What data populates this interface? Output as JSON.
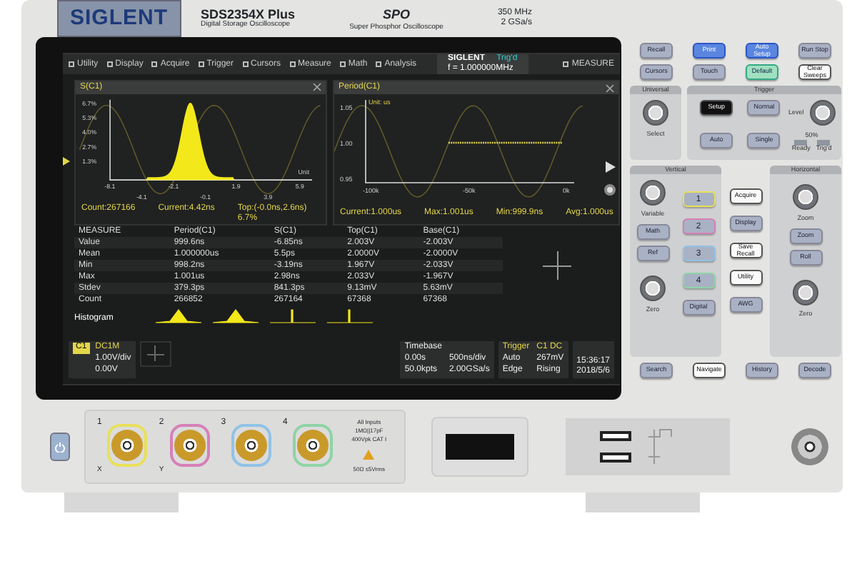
{
  "header": {
    "brand": "SIGLENT",
    "model": "SDS2354X Plus",
    "subtitle": "Digital Storage Oscilloscope",
    "tech_logo": "SPO",
    "tech_subtitle": "Super Phosphor Oscilloscope",
    "bandwidth": "350 MHz",
    "sample_rate": "2 GSa/s"
  },
  "screen": {
    "menu": [
      "Utility",
      "Display",
      "Acquire",
      "Trigger",
      "Cursors",
      "Measure",
      "Math",
      "Analysis"
    ],
    "brand": "SIGLENT",
    "trig_status": "Trig'd",
    "frequency": "f = 1.000000MHz",
    "mode": "MEASURE",
    "histogram_panel": {
      "title": "S(C1)",
      "yticks": [
        "6.7%",
        "5.3%",
        "4.0%",
        "2.7%",
        "1.3%"
      ],
      "xticks": [
        "-8.1",
        "-4.1",
        "-2.1",
        "-0.1",
        "1.9",
        "3.9",
        "5.9"
      ],
      "unit": "Unit",
      "stats": [
        "Count:267166",
        "Current:4.42ns",
        "Top:(-0.0ns,2.6ns) 6.7%"
      ]
    },
    "trend_panel": {
      "title": "Period(C1)",
      "unit": "Unit: us",
      "yticks": [
        "1.05",
        "1.00",
        "0.95"
      ],
      "xticks": [
        "-100k",
        "-50k",
        "0k"
      ],
      "stats": [
        "Current:1.000us",
        "Max:1.001us",
        "Min:999.9ns",
        "Avg:1.000us"
      ]
    },
    "table": {
      "columns": [
        "MEASURE",
        "Period(C1)",
        "S(C1)",
        "Top(C1)",
        "Base(C1)"
      ],
      "rows": [
        [
          "Value",
          "999.6ns",
          "-6.85ns",
          "2.003V",
          "-2.003V"
        ],
        [
          "Mean",
          "1.000000us",
          "5.5ps",
          "2.0000V",
          "-2.0000V"
        ],
        [
          "Min",
          "998.2ns",
          "-3.19ns",
          "1.967V",
          "-2.033V"
        ],
        [
          "Max",
          "1.001us",
          "2.98ns",
          "2.033V",
          "-1.967V"
        ],
        [
          "Stdev",
          "379.3ps",
          "841.3ps",
          "9.13mV",
          "5.63mV"
        ],
        [
          "Count",
          "266852",
          "267164",
          "67368",
          "67368"
        ]
      ],
      "histogram_label": "Histogram"
    },
    "channel": {
      "name": "C1",
      "coupling": "DC1M",
      "scale": "1.00V/div",
      "offset": "0.00V"
    },
    "timebase": {
      "title": "Timebase",
      "delay": "0.00s",
      "scale": "500ns/div",
      "points": "50.0kpts",
      "rate": "2.00GSa/s"
    },
    "trigger": {
      "title": "Trigger",
      "source": "C1 DC",
      "mode": "Auto",
      "level": "267mV",
      "type": "Edge",
      "slope": "Rising"
    },
    "clock": {
      "time": "15:36:17",
      "date": "2018/5/6"
    }
  },
  "panel": {
    "top_buttons": [
      {
        "label": "Recall",
        "kind": "gray"
      },
      {
        "label": "Print",
        "kind": "blue"
      },
      {
        "label": "Auto Setup",
        "kind": "blue"
      },
      {
        "label": "Run Stop",
        "kind": "gray"
      },
      {
        "label": "Cursors",
        "kind": "gray"
      },
      {
        "label": "Touch",
        "kind": "gray"
      },
      {
        "label": "Default",
        "kind": "green"
      },
      {
        "label": "Clear Sweeps",
        "kind": "white"
      }
    ],
    "universal": {
      "title": "Universal",
      "knob_label": "Select"
    },
    "trigger": {
      "title": "Trigger",
      "buttons": [
        {
          "label": "Setup",
          "kind": "black"
        },
        {
          "label": "Normal",
          "kind": "gray"
        },
        {
          "label": "Auto",
          "kind": "gray"
        },
        {
          "label": "Single",
          "kind": "gray"
        }
      ],
      "level_label": "Level",
      "level_hint": "50%",
      "indicators": [
        "Ready",
        "Trig'd"
      ]
    },
    "vertical": {
      "title": "Vertical",
      "knob_labels": [
        "Variable",
        "Zero"
      ],
      "buttons": [
        "Math",
        "Ref",
        "Digital"
      ],
      "channels": [
        {
          "label": "1",
          "color": "#e8e05a"
        },
        {
          "label": "2",
          "color": "#d77fb8"
        },
        {
          "label": "3",
          "color": "#8fc3e6"
        },
        {
          "label": "4",
          "color": "#8fd3a6"
        }
      ]
    },
    "middle": [
      {
        "label": "Acquire",
        "kind": "white"
      },
      {
        "label": "Display",
        "kind": "gray"
      },
      {
        "label": "Save Recall",
        "kind": "white"
      },
      {
        "label": "Utility",
        "kind": "white"
      },
      {
        "label": "AWG",
        "kind": "gray"
      }
    ],
    "horizontal": {
      "title": "Horizontal",
      "knob_labels": [
        "Zoom",
        "Zero"
      ],
      "buttons": [
        "Zoom",
        "Roll"
      ]
    },
    "bottom_buttons": [
      {
        "label": "Search",
        "kind": "gray"
      },
      {
        "label": "Navigate",
        "kind": "white"
      },
      {
        "label": "History",
        "kind": "gray"
      },
      {
        "label": "Decode",
        "kind": "gray"
      }
    ]
  },
  "inputs": {
    "connectors": [
      {
        "label": "1",
        "color": "#e8e05a",
        "axis": "X"
      },
      {
        "label": "2",
        "color": "#d77fb8",
        "axis": "Y"
      },
      {
        "label": "3",
        "color": "#8fc3e6"
      },
      {
        "label": "4",
        "color": "#8fd3a6"
      }
    ],
    "rating": "All Inputs 1MΩ||17pF 400Vpk CAT I",
    "impedance": "50Ω ≤5Vrms"
  }
}
